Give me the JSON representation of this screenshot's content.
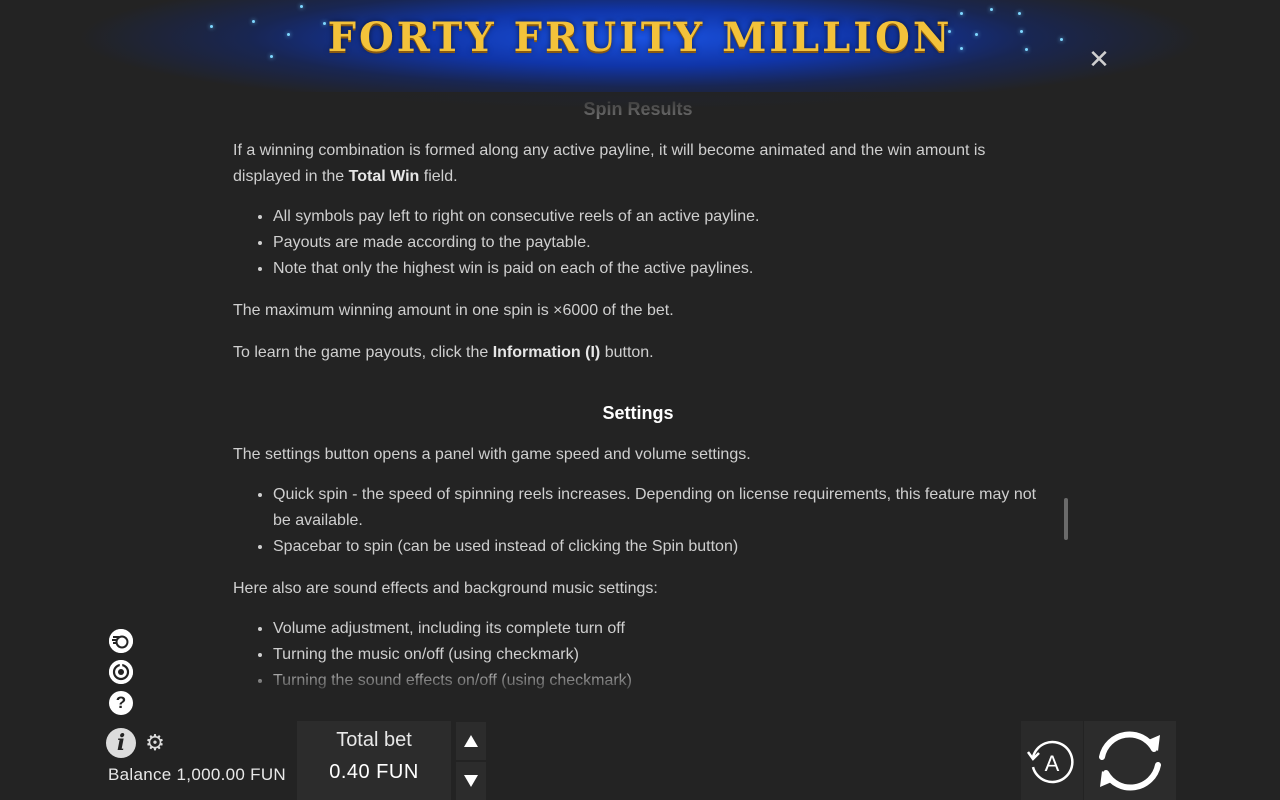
{
  "header": {
    "logo_text": "FORTY FRUITY MILLION",
    "close_label": "✕"
  },
  "content": {
    "section_spin_title": "Spin Results",
    "spin_intro_before": "If a winning combination is formed along any active payline, it will become animated and the win amount is displayed in the ",
    "spin_intro_bold": "Total Win",
    "spin_intro_after": " field.",
    "spin_bullets": [
      "All symbols pay left to right on consecutive reels of an active payline.",
      "Payouts are made according to the paytable.",
      "Note that only the highest win is paid on each of the active paylines."
    ],
    "max_win": "The maximum winning amount in one spin is ×6000 of the bet.",
    "payouts_before": "To learn the game payouts, click the ",
    "payouts_bold": "Information (I)",
    "payouts_after": " button.",
    "section_settings_title": "Settings",
    "settings_intro": "The settings button opens a panel with game speed and volume settings.",
    "settings_bullets": [
      "Quick spin - the speed of spinning reels increases. Depending on license requirements, this feature may not be available.",
      "Spacebar to spin (can be used instead of clicking the Spin button)"
    ],
    "sound_intro": "Here also are sound effects and background music settings:",
    "sound_bullets": [
      "Volume adjustment, including its complete turn off",
      "Turning the music on/off (using checkmark)",
      "Turning the sound effects on/off (using checkmark)"
    ]
  },
  "footer": {
    "balance": "Balance 1,000.00 FUN",
    "total_bet_label": "Total bet",
    "total_bet_value": "0.40 FUN",
    "auto_label": "A"
  },
  "colors": {
    "background": "#232323",
    "banner_blue": "#1a52e0",
    "logo_gold": "#f3c23a"
  }
}
